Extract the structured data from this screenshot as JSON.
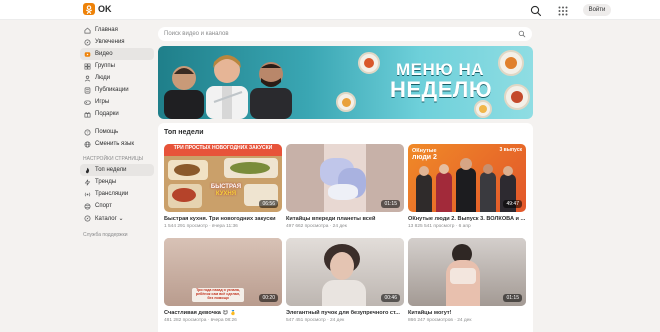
{
  "header": {
    "logo_text": "OK",
    "login_label": "Войти"
  },
  "sidebar": {
    "items": [
      {
        "label": "Главная",
        "icon": "home-icon"
      },
      {
        "label": "Увлечения",
        "icon": "compass-icon"
      },
      {
        "label": "Видео",
        "icon": "video-icon",
        "active": true
      },
      {
        "label": "Группы",
        "icon": "groups-icon"
      },
      {
        "label": "Люди",
        "icon": "people-icon"
      },
      {
        "label": "Публикации",
        "icon": "posts-icon"
      },
      {
        "label": "Игры",
        "icon": "games-icon"
      },
      {
        "label": "Подарки",
        "icon": "gift-icon"
      }
    ],
    "extra": [
      {
        "label": "Помощь",
        "icon": "help-icon"
      },
      {
        "label": "Сменить язык",
        "icon": "globe-icon"
      }
    ],
    "caption": "НАСТРОЙКИ СТРАНИЦЫ",
    "page_items": [
      {
        "label": "Топ недели",
        "icon": "top-icon",
        "active": true
      },
      {
        "label": "Тренды",
        "icon": "trends-icon"
      },
      {
        "label": "Трансляции",
        "icon": "live-icon"
      },
      {
        "label": "Спорт",
        "icon": "sport-icon"
      },
      {
        "label": "Каталог ⌄",
        "icon": "catalog-icon"
      }
    ],
    "support": "Служба поддержки"
  },
  "search": {
    "placeholder": "Поиск видео и каналов"
  },
  "banner": {
    "line1": "МЕНЮ НА",
    "line2": "НЕДЕЛЮ"
  },
  "section": {
    "title": "Топ недели"
  },
  "videos": [
    {
      "title": "Быстрая кухня. Три новогодних закуски",
      "views": "1 544 291 просмотр",
      "date": "вчера 11:36",
      "duration": "06:56",
      "overlay_top": "ТРИ ПРОСТЫХ НОВОГОДНИХ ЗАКУСКИ",
      "overlay_logo1": "БЫСТРАЯ",
      "overlay_logo2": "КУХНЯ"
    },
    {
      "title": "Китайцы впереди планеты всей",
      "views": "497 662 просмотра",
      "date": "24 дек",
      "duration": "01:15"
    },
    {
      "title": "ОКнутые люди 2. Выпуск 3. ВОЛКОВА и ...",
      "views": "13 825 541 просмотр",
      "date": "6 апр",
      "duration": "49:47",
      "overlay_left1": "ОКнутые",
      "overlay_left2": "люди 2",
      "overlay_right": "3 выпуск"
    },
    {
      "title": "Счастливая девочка 😍 🥇",
      "views": "481 282 просмотра",
      "date": "вчера 08:26",
      "duration": "00:20",
      "overlay_caption": "Три года назад я узнала, ребёнок сам всё сделал, без помощи"
    },
    {
      "title": "Элегантный пучок для безупречного ст...",
      "views": "547 451 просмотр",
      "date": "24 дек",
      "duration": "00:46"
    },
    {
      "title": "Китайцы могут!",
      "views": "866 247 просмотров",
      "date": "24 дек",
      "duration": "01:15"
    }
  ],
  "colors": {
    "brand": "#ee8208",
    "banner_teal": "#3aa6b3",
    "text": "#2c2d2e",
    "muted": "#8a8b8c"
  }
}
